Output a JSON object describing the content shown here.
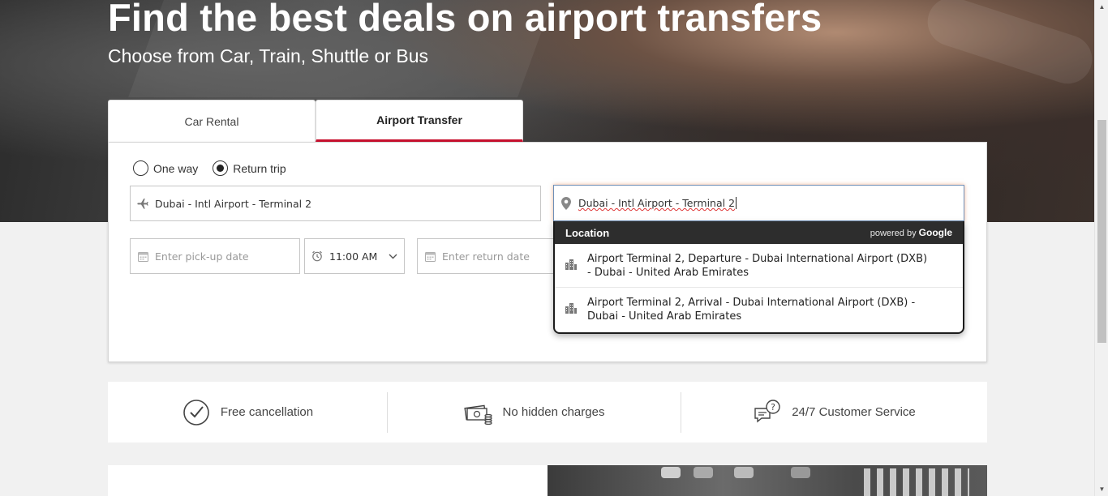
{
  "hero": {
    "title": "Find the best deals on airport transfers",
    "subtitle": "Choose from Car, Train, Shuttle or Bus"
  },
  "tabs": [
    {
      "label": "Car Rental",
      "active": false
    },
    {
      "label": "Airport Transfer",
      "active": true
    }
  ],
  "trip_type": {
    "one_way_label": "One way",
    "return_label": "Return trip",
    "selected": "Return trip"
  },
  "pickup": {
    "value": "Dubai - Intl Airport - Terminal 2",
    "icon": "plane-icon"
  },
  "dropoff": {
    "value": "Dubai - Intl Airport - Terminal 2",
    "icon": "location-pin-icon"
  },
  "pickup_date": {
    "placeholder": "Enter pick-up date",
    "icon": "calendar-icon"
  },
  "pickup_time": {
    "value": "11:00 AM",
    "icon": "alarm-clock-icon"
  },
  "return_date": {
    "placeholder": "Enter return date",
    "icon": "calendar-icon"
  },
  "autocomplete": {
    "header": "Location",
    "powered_by": "powered by",
    "provider": "Google",
    "items": [
      {
        "line1": "Airport Terminal 2, Departure - Dubai International Airport (DXB)",
        "line2": "- Dubai - United Arab Emirates",
        "icon": "building-icon"
      },
      {
        "line1": "Airport Terminal 2, Arrival - Dubai International Airport (DXB) -",
        "line2": "Dubai - United Arab Emirates",
        "icon": "building-icon"
      }
    ]
  },
  "features": [
    {
      "label": "Free cancellation",
      "icon": "check-circle-icon"
    },
    {
      "label": "No hidden charges",
      "icon": "money-icon"
    },
    {
      "label": "24/7 Customer Service",
      "icon": "chat-help-icon"
    }
  ],
  "colors": {
    "accent": "#c8102e",
    "autocomplete_header": "#2d2d2d"
  }
}
